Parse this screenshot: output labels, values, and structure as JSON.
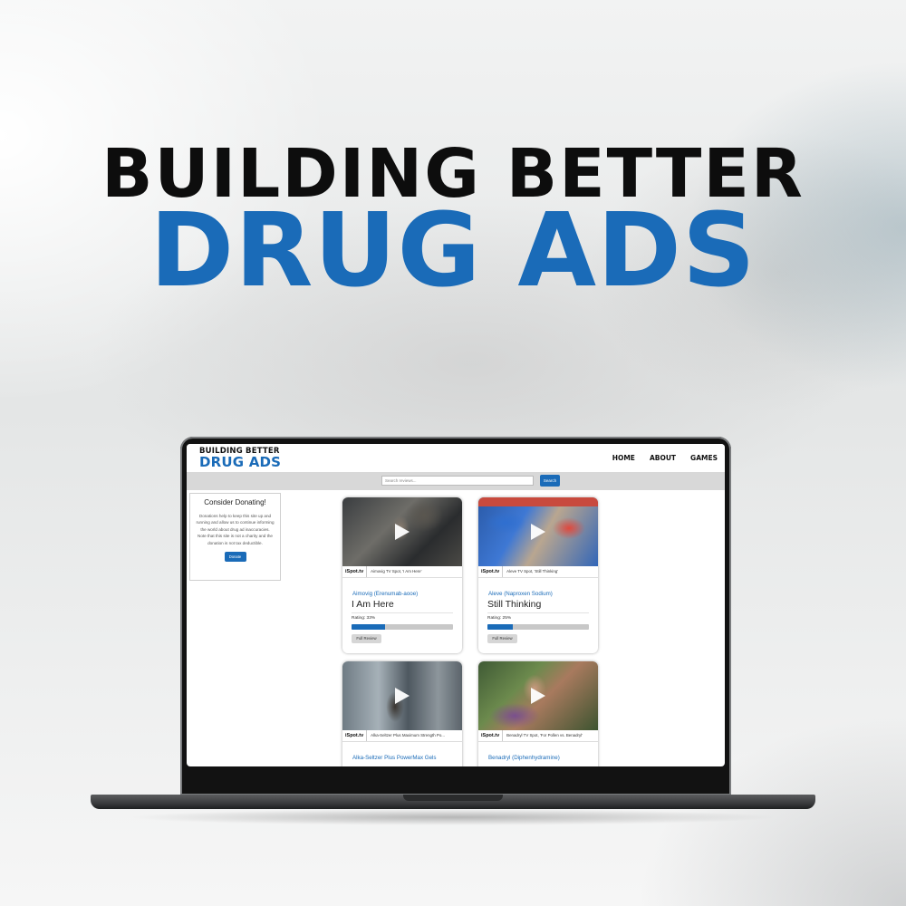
{
  "hero": {
    "line1": "BUILDING BETTER",
    "line2": "DRUG ADS"
  },
  "site": {
    "logo": {
      "line1": "BUILDING BETTER",
      "line2": "DRUG ADS"
    },
    "nav": [
      "HOME",
      "ABOUT",
      "GAMES"
    ],
    "search": {
      "placeholder": "Search reviews...",
      "button": "Search"
    },
    "donate": {
      "title": "Consider Donating!",
      "text": "Donations help to keep this site up and running and allow us to continue informing the world about drug ad inaccuracies. Note that this site is not a charity and the donation is not tax deductible.",
      "button": "Donate"
    },
    "cards": [
      {
        "caption": "Aimovig TV Spot, 'I Am Here'",
        "source": "iSpot.tv",
        "brand": "Aimovig (Erenumab-aooe)",
        "title": "I Am Here",
        "rating_label": "Rating: 33%",
        "rating": 0.33,
        "button": "Full Review"
      },
      {
        "caption": "Aleve TV Spot, 'Still Thinking'",
        "source": "iSpot.tv",
        "brand": "Aleve (Naproxen Sodium)",
        "title": "Still Thinking",
        "rating_label": "Rating: 25%",
        "rating": 0.25,
        "button": "Full Review"
      },
      {
        "caption": "Alka-Seltzer Plus Maximum Strength Po...",
        "source": "iSpot.tv",
        "brand": "Alka-Seltzer Plus PowerMax Gels",
        "title": "",
        "rating_label": "",
        "rating": null,
        "button": ""
      },
      {
        "caption": "Benadryl TV Spot, 'For Pollen vs. Benadryl'",
        "source": "iSpot.tv",
        "brand": "Benadryl (Diphenhydramine)",
        "title": "",
        "rating_label": "",
        "rating": null,
        "button": ""
      }
    ]
  },
  "colors": {
    "brand_blue": "#1a6bb8",
    "text_dark": "#111111"
  }
}
